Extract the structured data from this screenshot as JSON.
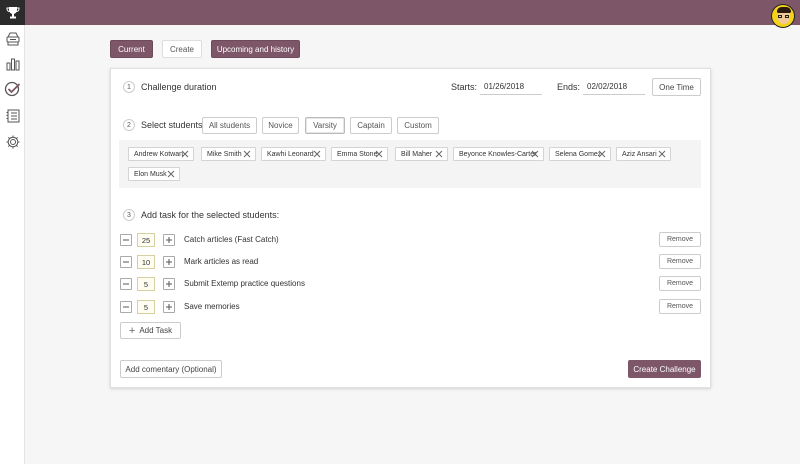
{
  "header": {
    "logo_icon": "trophy-icon",
    "avatar_icon": "user-avatar",
    "accent_color": "#7d5667"
  },
  "sidebar": {
    "items": [
      {
        "icon": "inbox-icon"
      },
      {
        "icon": "bar-chart-icon"
      },
      {
        "icon": "check-circle-icon"
      },
      {
        "icon": "list-icon"
      },
      {
        "icon": "gear-icon"
      }
    ]
  },
  "tabs": [
    {
      "label": "Current",
      "active": true
    },
    {
      "label": "Create",
      "active": false
    },
    {
      "label": "Upcoming and history",
      "active": true
    }
  ],
  "duration": {
    "step": "1",
    "title": "Challenge duration",
    "starts_label": "Starts:",
    "starts_value": "01/26/2018",
    "ends_label": "Ends:",
    "ends_value": "02/02/2018",
    "one_time_label": "One Time"
  },
  "students": {
    "step": "2",
    "title": "Select students",
    "groups": [
      "All students",
      "Novice",
      "Varsity",
      "Captain",
      "Custom"
    ],
    "selected_group": "Varsity",
    "chips": [
      "Andrew Kotwan",
      "Mike Smith",
      "Kawhi Leonard",
      "Emma Stone",
      "Bill Maher",
      "Beyonce Knowles-Carter",
      "Selena Gomez",
      "Aziz Ansari",
      "Elon Musk"
    ]
  },
  "tasks": {
    "step": "3",
    "title": "Add task for the selected students:",
    "rows": [
      {
        "qty": "25",
        "name": "Catch articles (Fast Catch)"
      },
      {
        "qty": "10",
        "name": "Mark articles as read"
      },
      {
        "qty": "5",
        "name": "Submit Extemp practice questions"
      },
      {
        "qty": "5",
        "name": "Save memories"
      }
    ],
    "remove_label": "Remove",
    "add_task_label": "Add Task"
  },
  "footer": {
    "commentary_label": "Add comentary (Optional)",
    "create_label": "Create Challenge"
  }
}
